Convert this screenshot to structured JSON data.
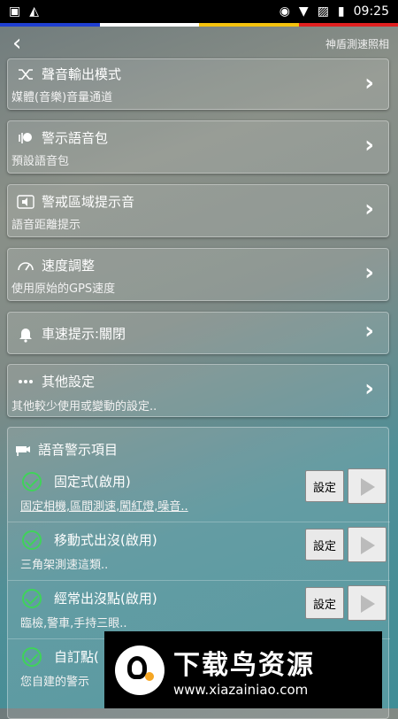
{
  "status": {
    "time": "09:25"
  },
  "color_strip": [
    "#1f3fd1",
    "#ffffff",
    "#f4c20d",
    "#e02020"
  ],
  "appbar": {
    "back_icon": "back-chevron-icon",
    "title": "神盾測速照相"
  },
  "settings": [
    {
      "icon": "shuffle-icon",
      "title": "聲音輸出模式",
      "sub": "媒體(音樂)音量通道"
    },
    {
      "icon": "speaker-head-icon",
      "title": "警示語音包",
      "sub": "預設語音包"
    },
    {
      "icon": "volume-icon",
      "title": "警戒區域提示音",
      "sub": "語音距離提示"
    },
    {
      "icon": "speedometer-icon",
      "title": "速度調整",
      "sub": "使用原始的GPS速度"
    },
    {
      "icon": "bell-icon",
      "title": "車速提示:關閉",
      "sub": ""
    },
    {
      "icon": "more-icon",
      "title": "其他設定",
      "sub": "其他較少使用或變動的設定.."
    }
  ],
  "voice": {
    "title": "語音警示項目",
    "set_label": "設定",
    "items": [
      {
        "title": "固定式(啟用)",
        "sub": "固定相機,區間測速,闖紅燈,噪音.."
      },
      {
        "title": "移動式出沒(啟用)",
        "sub": "三角架測速這類.."
      },
      {
        "title": "經常出沒點(啟用)",
        "sub": "臨檢,警車,手持三眼.."
      },
      {
        "title": "自訂點(",
        "sub": "您自建的警示"
      }
    ]
  },
  "watermark": {
    "cn": "下载鸟资源",
    "url": "www.xiazainiao.com"
  }
}
